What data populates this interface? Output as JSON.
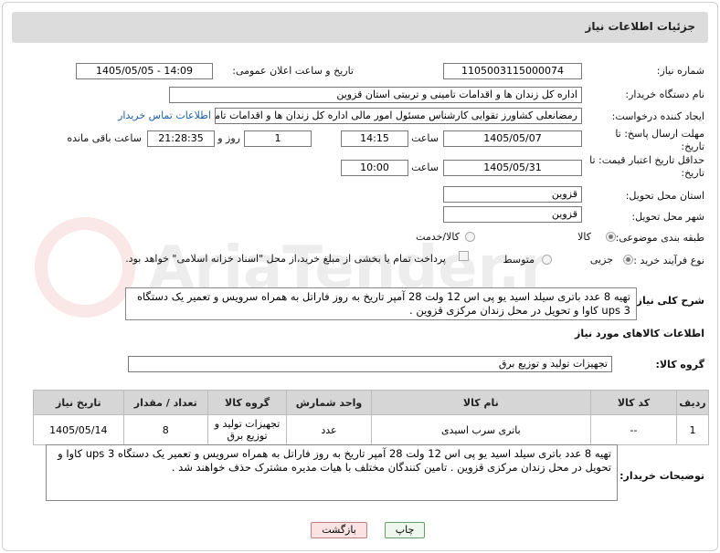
{
  "header": {
    "title": "جزئیات اطلاعات نیاز"
  },
  "fields": {
    "need_number_label": "شماره نیاز:",
    "need_number": "1105003115000074",
    "announce_label": "تاریخ و ساعت اعلان عمومی:",
    "announce_value": "1405/05/05 - 14:09",
    "buyer_org_label": "نام دستگاه خریدار:",
    "buyer_org": "اداره کل زندان ها و اقدامات تامینی و تربیتی استان قزوین",
    "requester_label": "ایجاد کننده درخواست:",
    "requester": "رمضانعلی کشاورز تقوایی کارشناس مسئول امور مالی  اداره کل زندان ها و اقدامات تامینی و تربیتی استان قزوین",
    "contact_link": "اطلاعات تماس خریدار",
    "reply_deadline_label": "مهلت ارسال پاسخ: تا تاریخ:",
    "reply_date": "1405/05/07",
    "time_label": "ساعت",
    "reply_time": "14:15",
    "days_value": "1",
    "days_label": "روز و",
    "remaining_time": "21:28:35",
    "remaining_label": "ساعت باقی مانده",
    "price_validity_label": "حداقل تاریخ اعتبار قیمت: تا تاریخ:",
    "price_date": "1405/05/31",
    "price_time": "10:00",
    "province_label": "استان محل تحویل:",
    "province": "قزوین",
    "city_label": "شهر محل تحویل:",
    "city": "قزوین",
    "category_label": "طبقه بندی موضوعی:",
    "category_options": [
      "کالا",
      "کالا/خدمت"
    ],
    "process_label": "نوع فرآیند خرید :",
    "process_options": [
      "جزیی",
      "متوسط"
    ],
    "payment_note": "پرداخت تمام یا بخشی از مبلغ خرید،از محل \"اسناد خزانه اسلامی\" خواهد بود.",
    "general_desc_label": "شرح کلی نیاز:",
    "general_desc": "تهیه 8 عدد باتری سیلد اسید یو پی اس 12 ولت 28 آمپر تاریخ به روز فاراتل به همراه سرویس و تعمیر یک دستگاه 3  ups کاوا و تحویل در محل زندان مرکزی قزوین .",
    "goods_info_title": "اطلاعات کالاهای مورد نیاز",
    "goods_group_label": "گروه کالا:",
    "goods_group": "تجهیزات تولید و توزیع برق",
    "buyer_notes_label": "توضیحات خریدار:",
    "buyer_notes": "تهیه 8 عدد باتری سیلد اسید یو پی اس 12 ولت 28 آمپر تاریخ به روز فاراتل به همراه سرویس و تعمیر یک دستگاه 3  ups کاوا و تحویل در محل زندان مرکزی قزوین . تامین کنندگان مختلف با هیات مدیره مشترک حذف خواهند شد ."
  },
  "table": {
    "headers": [
      "ردیف",
      "کد کالا",
      "نام کالا",
      "واحد شمارش",
      "گروه کالا",
      "تعداد / مقدار",
      "تاریخ نیاز"
    ],
    "rows": [
      [
        "1",
        "--",
        "باتری سرب اسیدی",
        "عدد",
        "تجهیزات تولید و توزیع برق",
        "8",
        "1405/05/14"
      ]
    ]
  },
  "buttons": {
    "print": "چاپ",
    "back": "بازگشت"
  },
  "watermark": "AriaTender.net"
}
